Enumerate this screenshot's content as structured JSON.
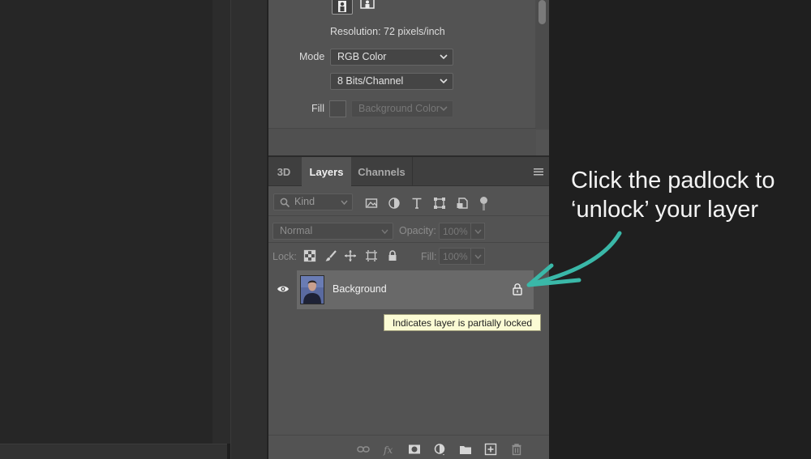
{
  "properties": {
    "resolution_text": "Resolution: 72 pixels/inch",
    "mode_label": "Mode",
    "mode_value": "RGB Color",
    "bits_value": "8 Bits/Channel",
    "fill_label": "Fill",
    "fill_value": "Background Color"
  },
  "layers_panel": {
    "tabs": [
      {
        "label": "3D",
        "active": false
      },
      {
        "label": "Layers",
        "active": true
      },
      {
        "label": "Channels",
        "active": false
      }
    ],
    "kind_filter": "Kind",
    "blend_mode": "Normal",
    "opacity_label": "Opacity:",
    "opacity_value": "100%",
    "lock_label": "Lock:",
    "fill_label": "Fill:",
    "fill_value": "100%",
    "layer": {
      "name": "Background",
      "visible": true,
      "locked": true
    },
    "tooltip": "Indicates layer is partially locked"
  },
  "annotation": {
    "text_line1": "Click the padlock to",
    "text_line2": "‘unlock’ your layer",
    "arrow_color": "#3ab8a8"
  },
  "colors": {
    "panel_bg": "#535353",
    "tooltip_bg": "#fbfbd4",
    "accent_arrow": "#3ab8a8"
  }
}
